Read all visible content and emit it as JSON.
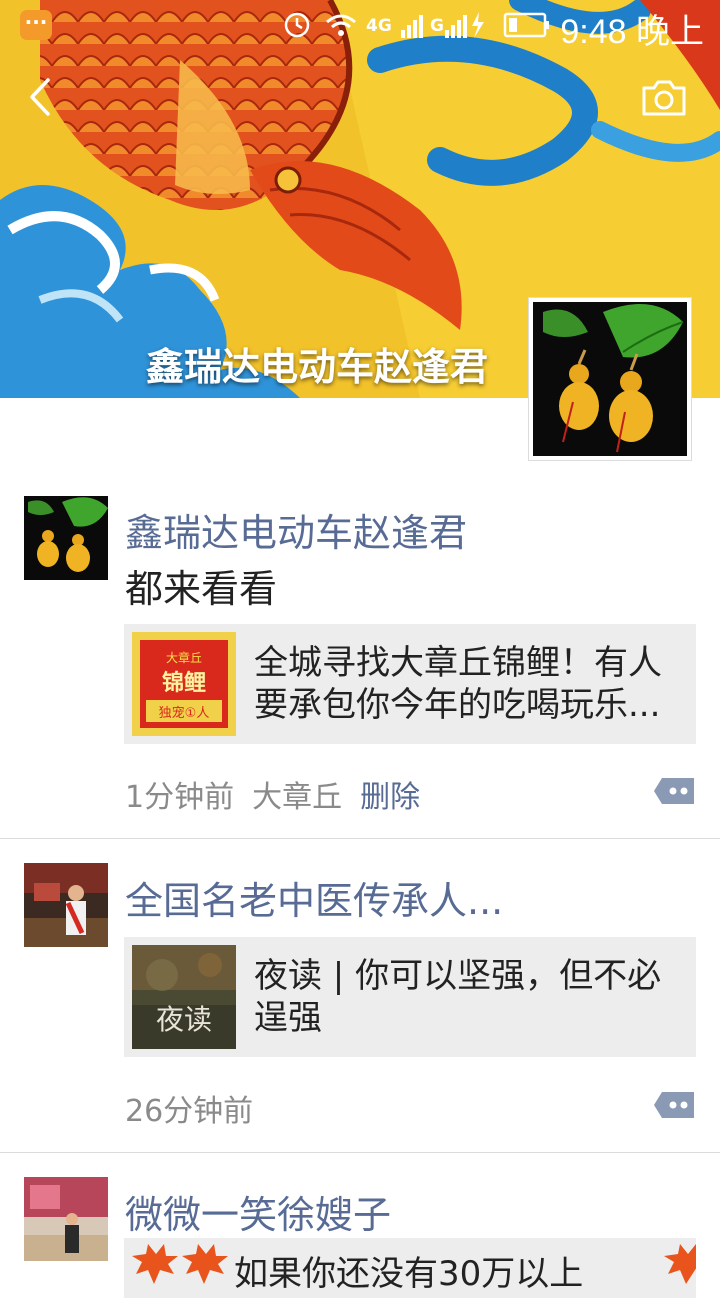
{
  "status_bar": {
    "notification_icon": "chat-bubble-icon",
    "network": "4G",
    "network2": "G",
    "time": "9:48 晚上"
  },
  "header": {
    "back_icon": "chevron-left-icon",
    "camera_icon": "camera-icon",
    "cover_name": "鑫瑞达电动车赵逢君",
    "cover_colors": {
      "fish": "#e04a1e",
      "water": "#2a8fd6",
      "background": "#f4c628"
    }
  },
  "posts": [
    {
      "author": "鑫瑞达电动车赵逢君",
      "text": "都来看看",
      "link": {
        "title": "全城寻找大章丘锦鲤！有人要承包你今年的吃喝玩乐...",
        "thumb_top": "大章丘",
        "thumb_main": "锦鲤",
        "thumb_bottom": "独宠①人"
      },
      "time": "1分钟前",
      "location": "大章丘",
      "delete_label": "删除"
    },
    {
      "author": "全国名老中医传承人...",
      "link": {
        "title": "夜读 | 你可以坚强，但不必逞强",
        "thumb_text": "夜读"
      },
      "time": "26分钟前"
    },
    {
      "author": "微微一笑徐嫂子",
      "link": {
        "title": "如果你还没有30万以上"
      }
    }
  ],
  "accent": {
    "link_blue": "#576b95"
  }
}
